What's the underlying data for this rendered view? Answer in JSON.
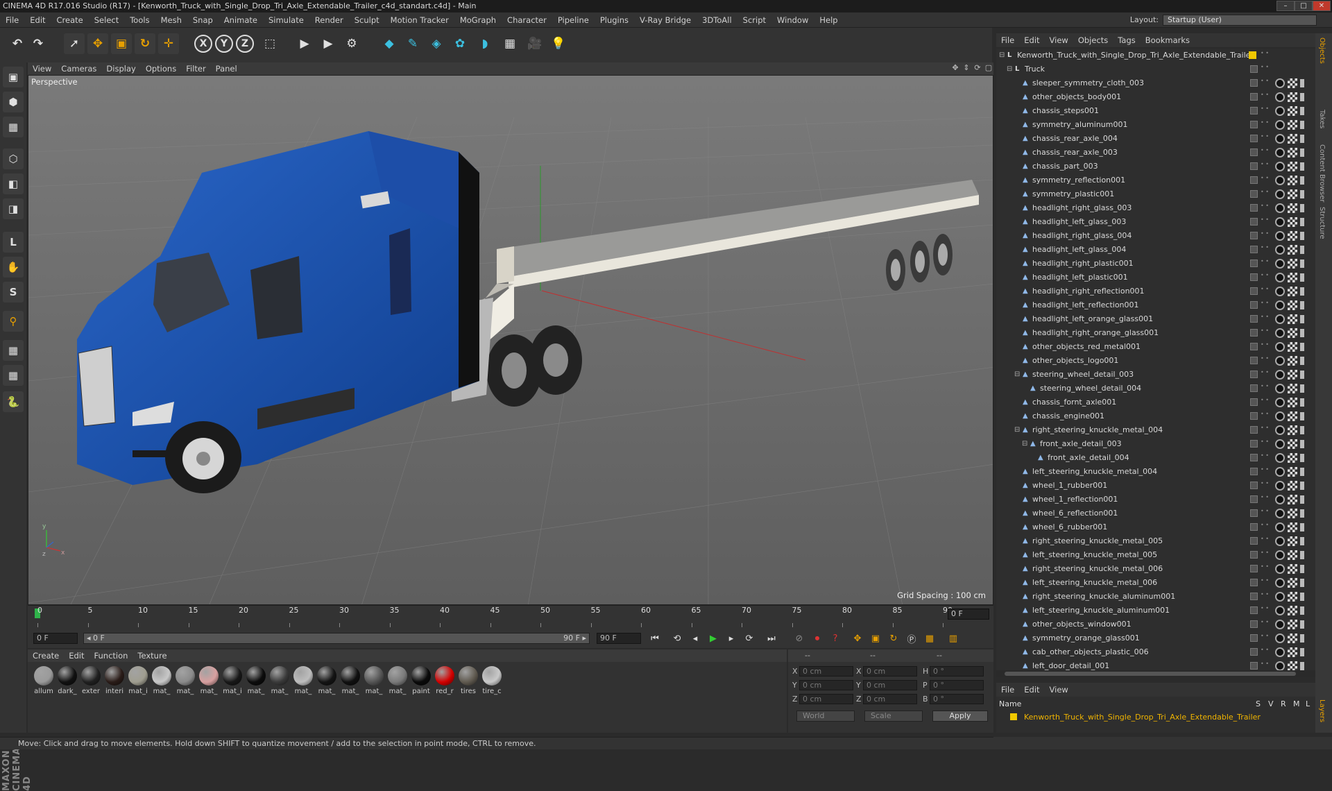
{
  "app": {
    "title": "CINEMA 4D R17.016 Studio (R17) - [Kenworth_Truck_with_Single_Drop_Tri_Axle_Extendable_Trailer_c4d_standart.c4d] - Main",
    "window_buttons": [
      "–",
      "□",
      "✕"
    ]
  },
  "menubar": {
    "items": [
      "File",
      "Edit",
      "Create",
      "Select",
      "Tools",
      "Mesh",
      "Snap",
      "Animate",
      "Simulate",
      "Render",
      "Sculpt",
      "Motion Tracker",
      "MoGraph",
      "Character",
      "Pipeline",
      "Plugins",
      "V-Ray Bridge",
      "3DToAll",
      "Script",
      "Window",
      "Help"
    ],
    "layout_label": "Layout:",
    "layout_value": "Startup (User)"
  },
  "toolbar": {
    "buttons": [
      {
        "name": "undo-button",
        "glyph": "↶"
      },
      {
        "name": "redo-button",
        "glyph": "↷"
      },
      {
        "name": "live-selection-button",
        "glyph": "➚"
      },
      {
        "name": "move-button",
        "glyph": "✥"
      },
      {
        "name": "scale-button",
        "glyph": "▣"
      },
      {
        "name": "rotate-button",
        "glyph": "↻"
      },
      {
        "name": "transform-button",
        "glyph": "✛"
      },
      {
        "name": "lock-x-button",
        "glyph": "X"
      },
      {
        "name": "lock-y-button",
        "glyph": "Y"
      },
      {
        "name": "lock-z-button",
        "glyph": "Z"
      },
      {
        "name": "coordinate-system-button",
        "glyph": "⬚"
      },
      {
        "name": "render-view-button",
        "glyph": "▶"
      },
      {
        "name": "render-picture-viewer-button",
        "glyph": "▶"
      },
      {
        "name": "render-settings-button",
        "glyph": "⚙"
      },
      {
        "name": "cube-button",
        "glyph": "◆"
      },
      {
        "name": "pen-button",
        "glyph": "✎"
      },
      {
        "name": "subdivision-button",
        "glyph": "◈"
      },
      {
        "name": "array-button",
        "glyph": "✿"
      },
      {
        "name": "deformer-button",
        "glyph": "◗"
      },
      {
        "name": "floor-button",
        "glyph": "▦"
      },
      {
        "name": "camera-button",
        "glyph": "🎥"
      },
      {
        "name": "light-button",
        "glyph": "💡"
      }
    ]
  },
  "left_tools": [
    "▣",
    "⬢",
    "▦",
    "⬡",
    "◧",
    "◨",
    "L",
    "✋",
    "S",
    "⚲",
    "▦",
    "▦",
    "🐍"
  ],
  "maxon_logo": "MAXON CINEMA 4D",
  "viewport": {
    "menu": [
      "View",
      "Cameras",
      "Display",
      "Options",
      "Filter",
      "Panel"
    ],
    "label": "Perspective",
    "grid_spacing": "Grid Spacing : 100 cm"
  },
  "timeline": {
    "ticks": [
      "0",
      "5",
      "10",
      "15",
      "20",
      "25",
      "30",
      "35",
      "40",
      "45",
      "50",
      "55",
      "60",
      "65",
      "70",
      "75",
      "80",
      "85",
      "90"
    ],
    "current_frame": "0 F",
    "start_field": "0 F",
    "range_start": "◂ 0 F",
    "range_end": "90 F ▸",
    "end_field": "90 F"
  },
  "materials": {
    "menu": [
      "Create",
      "Edit",
      "Function",
      "Texture"
    ],
    "items": [
      {
        "label": "allum",
        "color": "#9a9a9a"
      },
      {
        "label": "dark_",
        "color": "#111111"
      },
      {
        "label": "exter",
        "color": "#202020"
      },
      {
        "label": "interi",
        "color": "#2a1c18"
      },
      {
        "label": "mat_i",
        "color": "#a09e90"
      },
      {
        "label": "mat_",
        "color": "#c8c8c8"
      },
      {
        "label": "mat_",
        "color": "#8a8a8a"
      },
      {
        "label": "mat_",
        "color": "#d8a0a0"
      },
      {
        "label": "mat_i",
        "color": "#181818"
      },
      {
        "label": "mat_",
        "color": "#0c0c0c"
      },
      {
        "label": "mat_",
        "color": "#3a3a3a"
      },
      {
        "label": "mat_",
        "color": "#bdbdbd"
      },
      {
        "label": "mat_",
        "color": "#141414"
      },
      {
        "label": "mat_",
        "color": "#101010"
      },
      {
        "label": "mat_",
        "color": "#555555"
      },
      {
        "label": "mat_",
        "color": "#7a7a7a"
      },
      {
        "label": "paint",
        "color": "#0a0a0a"
      },
      {
        "label": "red_r",
        "color": "#d40000"
      },
      {
        "label": "tires",
        "color": "#605a50"
      },
      {
        "label": "tire_c",
        "color": "#c9c9c9"
      }
    ]
  },
  "coords": {
    "header": [
      "--",
      "--",
      "--"
    ],
    "rows": [
      {
        "a": "X",
        "v1": "0 cm",
        "b": "X",
        "v2": "0 cm",
        "c": "H",
        "v3": "0 °"
      },
      {
        "a": "Y",
        "v1": "0 cm",
        "b": "Y",
        "v2": "0 cm",
        "c": "P",
        "v3": "0 °"
      },
      {
        "a": "Z",
        "v1": "0 cm",
        "b": "Z",
        "v2": "0 cm",
        "c": "B",
        "v3": "0 °"
      }
    ],
    "mode": "World",
    "scale": "Scale",
    "apply": "Apply"
  },
  "statusbar": "Move: Click and drag to move elements. Hold down SHIFT to quantize movement / add to the selection in point mode, CTRL to remove.",
  "object_manager": {
    "menu": [
      "File",
      "Edit",
      "View",
      "Objects",
      "Tags",
      "Bookmarks"
    ],
    "objects": [
      {
        "label": "Kenworth_Truck_with_Single_Drop_Tri_Axle_Extendable_Trailer",
        "indent": 0,
        "kind": "null",
        "root": true
      },
      {
        "label": "Truck",
        "indent": 1,
        "kind": "null"
      },
      {
        "label": "sleeper_symmetry_cloth_003",
        "indent": 2,
        "kind": "poly"
      },
      {
        "label": "other_objects_body001",
        "indent": 2,
        "kind": "poly"
      },
      {
        "label": "chassis_steps001",
        "indent": 2,
        "kind": "poly"
      },
      {
        "label": "symmetry_aluminum001",
        "indent": 2,
        "kind": "poly"
      },
      {
        "label": "chassis_rear_axle_004",
        "indent": 2,
        "kind": "poly"
      },
      {
        "label": "chassis_rear_axle_003",
        "indent": 2,
        "kind": "poly"
      },
      {
        "label": "chassis_part_003",
        "indent": 2,
        "kind": "poly"
      },
      {
        "label": "symmetry_reflection001",
        "indent": 2,
        "kind": "poly"
      },
      {
        "label": "symmetry_plastic001",
        "indent": 2,
        "kind": "poly"
      },
      {
        "label": "headlight_right_glass_003",
        "indent": 2,
        "kind": "poly"
      },
      {
        "label": "headlight_left_glass_003",
        "indent": 2,
        "kind": "poly"
      },
      {
        "label": "headlight_right_glass_004",
        "indent": 2,
        "kind": "poly"
      },
      {
        "label": "headlight_left_glass_004",
        "indent": 2,
        "kind": "poly"
      },
      {
        "label": "headlight_right_plastic001",
        "indent": 2,
        "kind": "poly"
      },
      {
        "label": "headlight_left_plastic001",
        "indent": 2,
        "kind": "poly"
      },
      {
        "label": "headlight_right_reflection001",
        "indent": 2,
        "kind": "poly"
      },
      {
        "label": "headlight_left_reflection001",
        "indent": 2,
        "kind": "poly"
      },
      {
        "label": "headlight_left_orange_glass001",
        "indent": 2,
        "kind": "poly"
      },
      {
        "label": "headlight_right_orange_glass001",
        "indent": 2,
        "kind": "poly"
      },
      {
        "label": "other_objects_red_metal001",
        "indent": 2,
        "kind": "poly"
      },
      {
        "label": "other_objects_logo001",
        "indent": 2,
        "kind": "poly"
      },
      {
        "label": "steering_wheel_detail_003",
        "indent": 2,
        "kind": "poly",
        "expand": true
      },
      {
        "label": "steering_wheel_detail_004",
        "indent": 3,
        "kind": "poly"
      },
      {
        "label": "chassis_fornt_axle001",
        "indent": 2,
        "kind": "poly"
      },
      {
        "label": "chassis_engine001",
        "indent": 2,
        "kind": "poly"
      },
      {
        "label": "right_steering_knuckle_metal_004",
        "indent": 2,
        "kind": "poly",
        "expand": true
      },
      {
        "label": "front_axle_detail_003",
        "indent": 3,
        "kind": "poly",
        "expand": true
      },
      {
        "label": "front_axle_detail_004",
        "indent": 4,
        "kind": "poly"
      },
      {
        "label": "left_steering_knuckle_metal_004",
        "indent": 2,
        "kind": "poly"
      },
      {
        "label": "wheel_1_rubber001",
        "indent": 2,
        "kind": "poly"
      },
      {
        "label": "wheel_1_reflection001",
        "indent": 2,
        "kind": "poly"
      },
      {
        "label": "wheel_6_reflection001",
        "indent": 2,
        "kind": "poly"
      },
      {
        "label": "wheel_6_rubber001",
        "indent": 2,
        "kind": "poly"
      },
      {
        "label": "right_steering_knuckle_metal_005",
        "indent": 2,
        "kind": "poly"
      },
      {
        "label": "left_steering_knuckle_metal_005",
        "indent": 2,
        "kind": "poly"
      },
      {
        "label": "right_steering_knuckle_metal_006",
        "indent": 2,
        "kind": "poly"
      },
      {
        "label": "left_steering_knuckle_metal_006",
        "indent": 2,
        "kind": "poly"
      },
      {
        "label": "right_steering_knuckle_aluminum001",
        "indent": 2,
        "kind": "poly"
      },
      {
        "label": "left_steering_knuckle_aluminum001",
        "indent": 2,
        "kind": "poly"
      },
      {
        "label": "other_objects_window001",
        "indent": 2,
        "kind": "poly"
      },
      {
        "label": "symmetry_orange_glass001",
        "indent": 2,
        "kind": "poly"
      },
      {
        "label": "cab_other_objects_plastic_006",
        "indent": 2,
        "kind": "poly"
      },
      {
        "label": "left_door_detail_001",
        "indent": 2,
        "kind": "poly"
      }
    ]
  },
  "side_tabs": [
    "Objects",
    "Takes",
    "Content Browser",
    "Structure"
  ],
  "attributes": {
    "menu": [
      "File",
      "Edit",
      "View"
    ],
    "layers_columns": [
      "Name",
      "S",
      "V",
      "R",
      "M",
      "L"
    ],
    "layer_name": "Kenworth_Truck_with_Single_Drop_Tri_Axle_Extendable_Trailer",
    "side_tab": "Layers",
    "layer_color": "#f0c800"
  }
}
